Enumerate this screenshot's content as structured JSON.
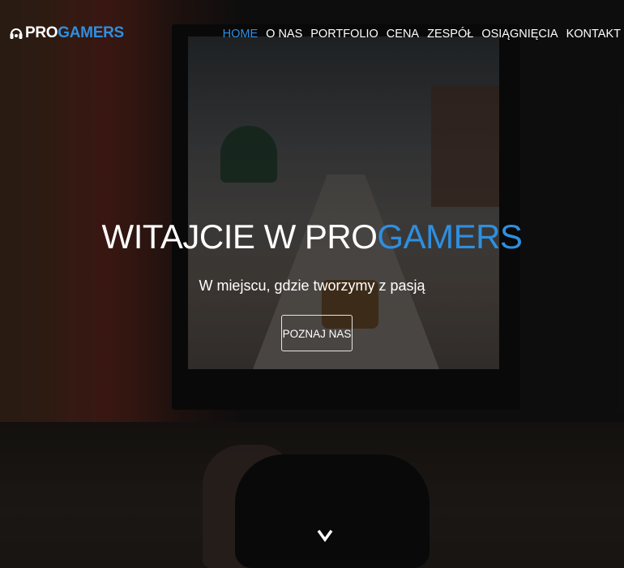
{
  "brand": {
    "name_part1": "PRO",
    "name_part2": "GAMERS",
    "logo_icon": "headset-icon",
    "accent_color": "#2e8fe0"
  },
  "nav": {
    "items": [
      {
        "label": "HOME",
        "active": true
      },
      {
        "label": "O NAS",
        "active": false
      },
      {
        "label": "PORTFOLIO",
        "active": false
      },
      {
        "label": "CENA",
        "active": false
      },
      {
        "label": "ZESPÓŁ",
        "active": false
      },
      {
        "label": "OSIĄGNIĘCIA",
        "active": false
      },
      {
        "label": "KONTAKT",
        "active": false
      }
    ]
  },
  "hero": {
    "title_part1": "WITAJCIE W PRO",
    "title_part2": "GAMERS",
    "subtitle": "W miejscu, gdzie tworzymy z pasją",
    "cta_label": "POZNAJ NAS",
    "scroll_icon": "chevron-down-icon"
  }
}
